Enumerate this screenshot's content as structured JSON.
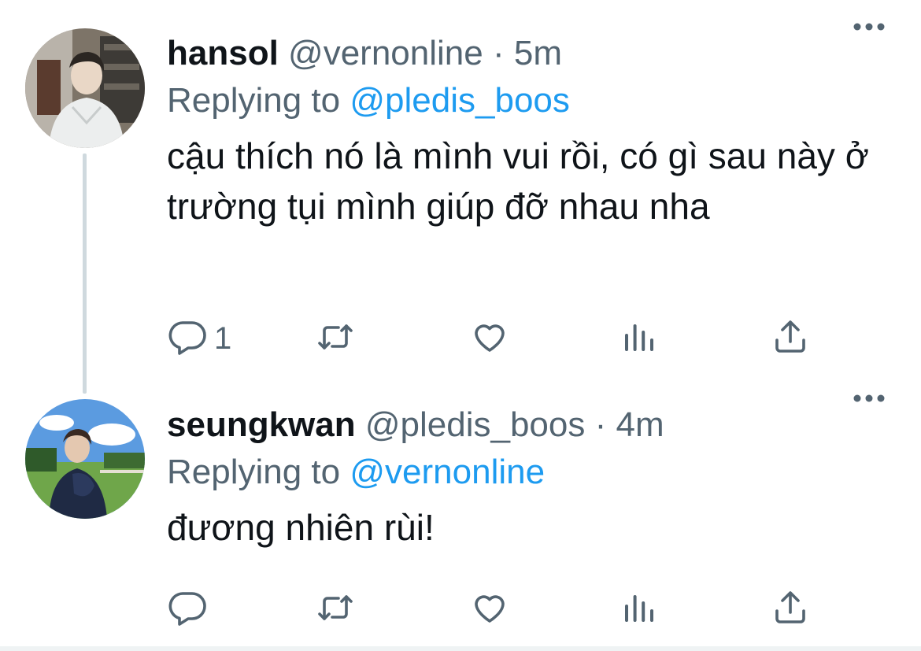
{
  "tweets": [
    {
      "name": "hansol",
      "handle": "@vernonline",
      "separator": "·",
      "time": "5m",
      "replying_prefix": "Replying to",
      "replying_to": "@pledis_boos",
      "text": "cậu thích nó là mình vui rồi, có gì sau này ở trường tụi mình giúp đỡ nhau nha",
      "reply_count": "1",
      "icons": [
        "more-icon",
        "reply-icon",
        "retweet-icon",
        "like-icon",
        "analytics-icon",
        "share-icon"
      ]
    },
    {
      "name": "seungkwan",
      "handle": "@pledis_boos",
      "separator": "·",
      "time": "4m",
      "replying_prefix": "Replying to",
      "replying_to": "@vernonline",
      "text": "đương nhiên rùi!",
      "reply_count": "",
      "icons": [
        "more-icon",
        "reply-icon",
        "retweet-icon",
        "like-icon",
        "analytics-icon",
        "share-icon"
      ]
    }
  ],
  "colors": {
    "text": "#0f1419",
    "secondary": "#536471",
    "accent": "#1d9bf0",
    "thread_line": "#cfd9de"
  }
}
